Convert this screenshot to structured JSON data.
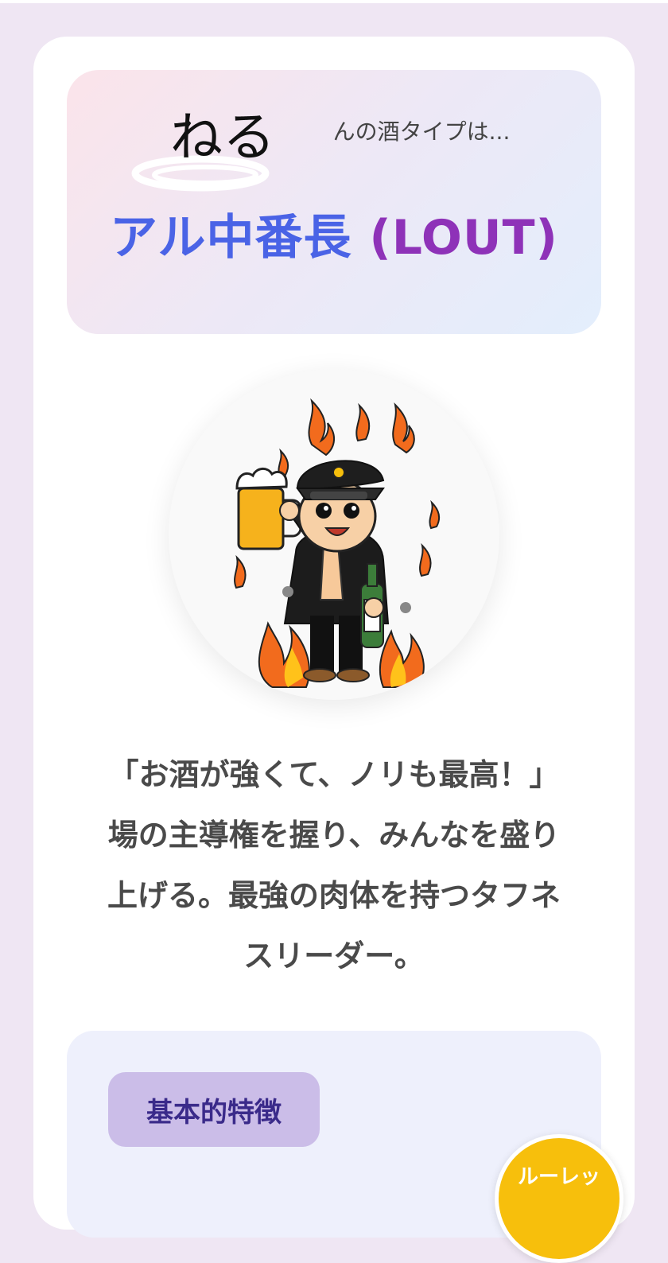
{
  "header": {
    "handwritten_name": "ねる",
    "intro_suffix": "んの酒タイプは...",
    "type_name_jp": "アル中番長",
    "type_code": "(LOUT)"
  },
  "avatar": {
    "icon": "drunk-gang-leader-character-icon"
  },
  "description": {
    "lines": [
      "「お酒が強くて、ノリも最高！」",
      "場の主導権を握り、みんなを盛り",
      "上げる。最強の肉体を持つタフネ",
      "スリーダー。"
    ]
  },
  "features": {
    "tag_label": "基本的特徴"
  },
  "roulette": {
    "label": "ルーレッ"
  },
  "colors": {
    "background": "#efe6f3",
    "title_blue": "#4a63e6",
    "title_purple": "#8e32b8",
    "tag_bg": "#cbbde8",
    "tag_text": "#3a2a8a",
    "roulette_yellow": "#f7bf0c"
  }
}
